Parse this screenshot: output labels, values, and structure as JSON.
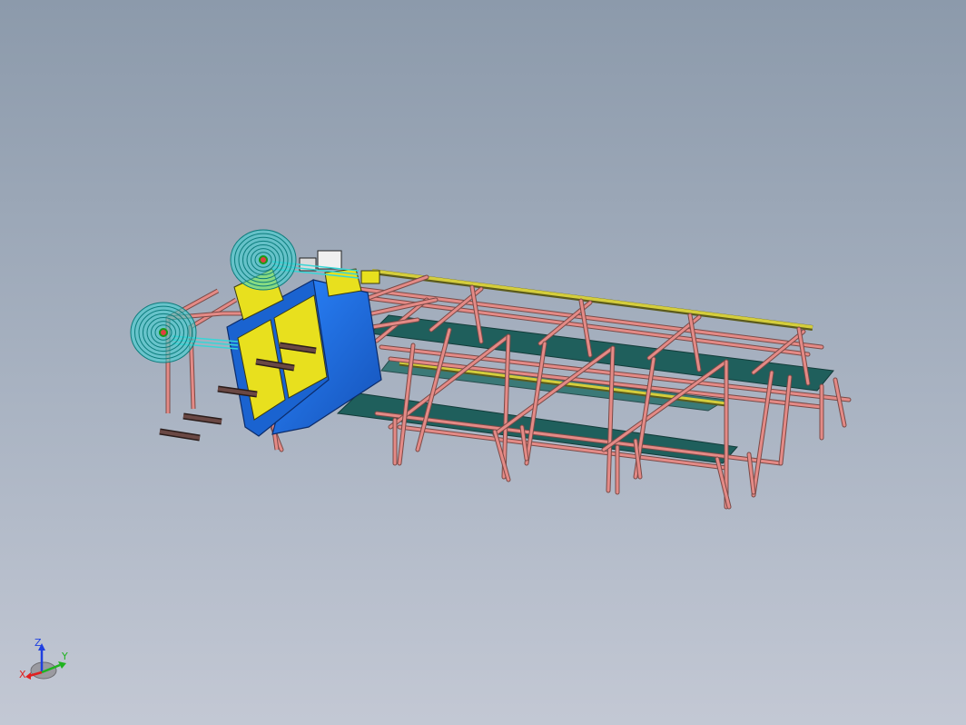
{
  "viewport": {
    "background_top": "#8c9aab",
    "background_bottom": "#c3c8d4"
  },
  "model": {
    "frame_color": "#e48a86",
    "rail_color": "#c9c23a",
    "panel_color": "#1f5f5c",
    "cabinet_front_color": "#e8e01e",
    "cabinet_body_color": "#1b6fe0",
    "spool_color": "#37d6d6",
    "bar_color": "#5a3a36"
  },
  "triad": {
    "x_label": "X",
    "y_label": "Y",
    "z_label": "Z",
    "x_color": "#e02020",
    "y_color": "#1fb31f",
    "z_color": "#2040e0"
  }
}
